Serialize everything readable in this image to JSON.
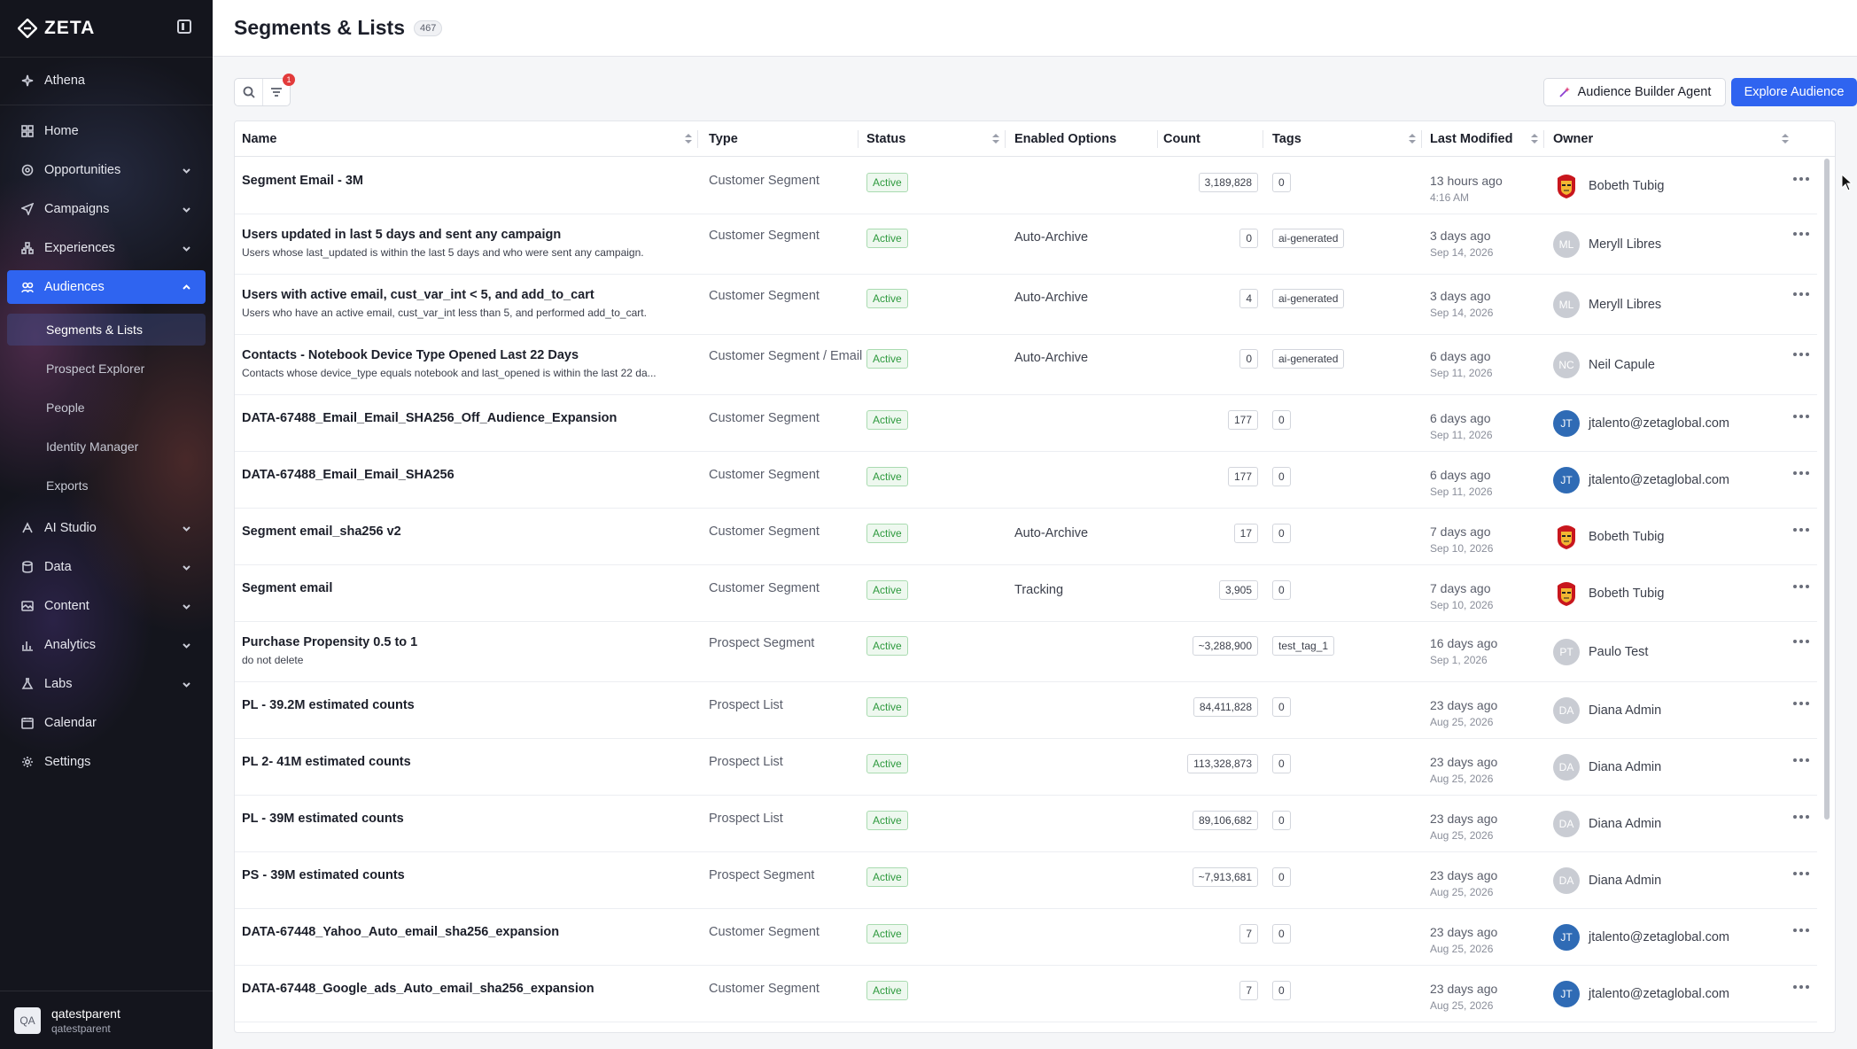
{
  "app": {
    "brand": "ZETA"
  },
  "sidebar": {
    "athena": "Athena",
    "items": [
      {
        "label": "Home",
        "icon": "grid-icon",
        "chevron": false
      },
      {
        "label": "Opportunities",
        "icon": "target-icon",
        "chevron": true
      },
      {
        "label": "Campaigns",
        "icon": "send-icon",
        "chevron": true
      },
      {
        "label": "Experiences",
        "icon": "flow-icon",
        "chevron": true
      },
      {
        "label": "Audiences",
        "icon": "audience-icon",
        "chevron": true,
        "active": true
      }
    ],
    "sub_items": [
      "Segments & Lists",
      "Prospect Explorer",
      "People",
      "Identity Manager",
      "Exports"
    ],
    "items_bottom": [
      {
        "label": "AI Studio",
        "icon": "ai-icon",
        "chevron": true
      },
      {
        "label": "Data",
        "icon": "database-icon",
        "chevron": true
      },
      {
        "label": "Content",
        "icon": "content-icon",
        "chevron": true
      },
      {
        "label": "Analytics",
        "icon": "analytics-icon",
        "chevron": true
      },
      {
        "label": "Labs",
        "icon": "labs-icon",
        "chevron": true
      },
      {
        "label": "Calendar",
        "icon": "calendar-icon",
        "chevron": false
      },
      {
        "label": "Settings",
        "icon": "gear-icon",
        "chevron": false
      }
    ],
    "user": {
      "initials": "QA",
      "name": "qatestparent",
      "handle": "qatestparent"
    }
  },
  "header": {
    "title": "Segments & Lists",
    "count": "467"
  },
  "toolbar": {
    "filter_count": "1",
    "agent_label": "Audience Builder Agent",
    "explore_label": "Explore Audience"
  },
  "table": {
    "columns": [
      "Name",
      "Type",
      "Status",
      "Enabled Options",
      "Count",
      "Tags",
      "Last Modified",
      "Owner"
    ],
    "rows": [
      {
        "name": "Segment Email - 3M",
        "desc": "",
        "type": "Customer Segment",
        "status": "Active",
        "options": "",
        "count": "3,189,828",
        "tag": "0",
        "modified": "13 hours ago",
        "modified_sub": "4:16 AM",
        "owner": "Bobeth Tubig",
        "avatar": "iron",
        "initials": ""
      },
      {
        "name": "Users updated in last 5 days and sent any campaign",
        "desc": "Users whose last_updated is within the last 5 days and who were sent any campaign.",
        "type": "Customer Segment",
        "status": "Active",
        "options": "Auto-Archive",
        "count": "0",
        "tag": "ai-generated",
        "modified": "3 days ago",
        "modified_sub": "Sep 14, 2026",
        "owner": "Meryll Libres",
        "avatar": "gray",
        "initials": "ML"
      },
      {
        "name": "Users with active email, cust_var_int < 5, and add_to_cart",
        "desc": "Users who have an active email, cust_var_int less than 5, and performed add_to_cart.",
        "type": "Customer Segment",
        "status": "Active",
        "options": "Auto-Archive",
        "count": "4",
        "tag": "ai-generated",
        "modified": "3 days ago",
        "modified_sub": "Sep 14, 2026",
        "owner": "Meryll Libres",
        "avatar": "gray",
        "initials": "ML"
      },
      {
        "name": "Contacts - Notebook Device Type Opened Last 22 Days",
        "desc": "Contacts whose device_type equals notebook and last_opened is within the last 22 da...",
        "type": "Customer Segment / Email",
        "status": "Active",
        "options": "Auto-Archive",
        "count": "0",
        "tag": "ai-generated",
        "modified": "6 days ago",
        "modified_sub": "Sep 11, 2026",
        "owner": "Neil Capule",
        "avatar": "gray",
        "initials": "NC"
      },
      {
        "name": "DATA-67488_Email_Email_SHA256_Off_Audience_Expansion",
        "desc": "",
        "type": "Customer Segment",
        "status": "Active",
        "options": "",
        "count": "177",
        "tag": "0",
        "modified": "6 days ago",
        "modified_sub": "Sep 11, 2026",
        "owner": "jtalento@zetaglobal.com",
        "avatar": "blue",
        "initials": "JT"
      },
      {
        "name": "DATA-67488_Email_Email_SHA256",
        "desc": "",
        "type": "Customer Segment",
        "status": "Active",
        "options": "",
        "count": "177",
        "tag": "0",
        "modified": "6 days ago",
        "modified_sub": "Sep 11, 2026",
        "owner": "jtalento@zetaglobal.com",
        "avatar": "blue",
        "initials": "JT"
      },
      {
        "name": "Segment email_sha256 v2",
        "desc": "",
        "type": "Customer Segment",
        "status": "Active",
        "options": "Auto-Archive",
        "count": "17",
        "tag": "0",
        "modified": "7 days ago",
        "modified_sub": "Sep 10, 2026",
        "owner": "Bobeth Tubig",
        "avatar": "iron",
        "initials": ""
      },
      {
        "name": "Segment email",
        "desc": "",
        "type": "Customer Segment",
        "status": "Active",
        "options": "Tracking",
        "count": "3,905",
        "tag": "0",
        "modified": "7 days ago",
        "modified_sub": "Sep 10, 2026",
        "owner": "Bobeth Tubig",
        "avatar": "iron",
        "initials": ""
      },
      {
        "name": "Purchase Propensity 0.5 to 1",
        "desc": "do not delete",
        "type": "Prospect Segment",
        "status": "Active",
        "options": "",
        "count": "~3,288,900",
        "tag": "test_tag_1",
        "modified": "16 days ago",
        "modified_sub": "Sep 1, 2026",
        "owner": "Paulo Test",
        "avatar": "gray",
        "initials": "PT"
      },
      {
        "name": "PL - 39.2M estimated counts",
        "desc": "",
        "type": "Prospect List",
        "status": "Active",
        "options": "",
        "count": "84,411,828",
        "tag": "0",
        "modified": "23 days ago",
        "modified_sub": "Aug 25, 2026",
        "owner": "Diana Admin",
        "avatar": "gray",
        "initials": "DA"
      },
      {
        "name": "PL 2- 41M estimated counts",
        "desc": "",
        "type": "Prospect List",
        "status": "Active",
        "options": "",
        "count": "113,328,873",
        "tag": "0",
        "modified": "23 days ago",
        "modified_sub": "Aug 25, 2026",
        "owner": "Diana Admin",
        "avatar": "gray",
        "initials": "DA"
      },
      {
        "name": "PL - 39M estimated counts",
        "desc": "",
        "type": "Prospect List",
        "status": "Active",
        "options": "",
        "count": "89,106,682",
        "tag": "0",
        "modified": "23 days ago",
        "modified_sub": "Aug 25, 2026",
        "owner": "Diana Admin",
        "avatar": "gray",
        "initials": "DA"
      },
      {
        "name": "PS - 39M estimated counts",
        "desc": "",
        "type": "Prospect Segment",
        "status": "Active",
        "options": "",
        "count": "~7,913,681",
        "tag": "0",
        "modified": "23 days ago",
        "modified_sub": "Aug 25, 2026",
        "owner": "Diana Admin",
        "avatar": "gray",
        "initials": "DA"
      },
      {
        "name": "DATA-67448_Yahoo_Auto_email_sha256_expansion",
        "desc": "",
        "type": "Customer Segment",
        "status": "Active",
        "options": "",
        "count": "7",
        "tag": "0",
        "modified": "23 days ago",
        "modified_sub": "Aug 25, 2026",
        "owner": "jtalento@zetaglobal.com",
        "avatar": "blue",
        "initials": "JT"
      },
      {
        "name": "DATA-67448_Google_ads_Auto_email_sha256_expansion",
        "desc": "",
        "type": "Customer Segment",
        "status": "Active",
        "options": "",
        "count": "7",
        "tag": "0",
        "modified": "23 days ago",
        "modified_sub": "Aug 25, 2026",
        "owner": "jtalento@zetaglobal.com",
        "avatar": "blue",
        "initials": "JT"
      }
    ]
  }
}
